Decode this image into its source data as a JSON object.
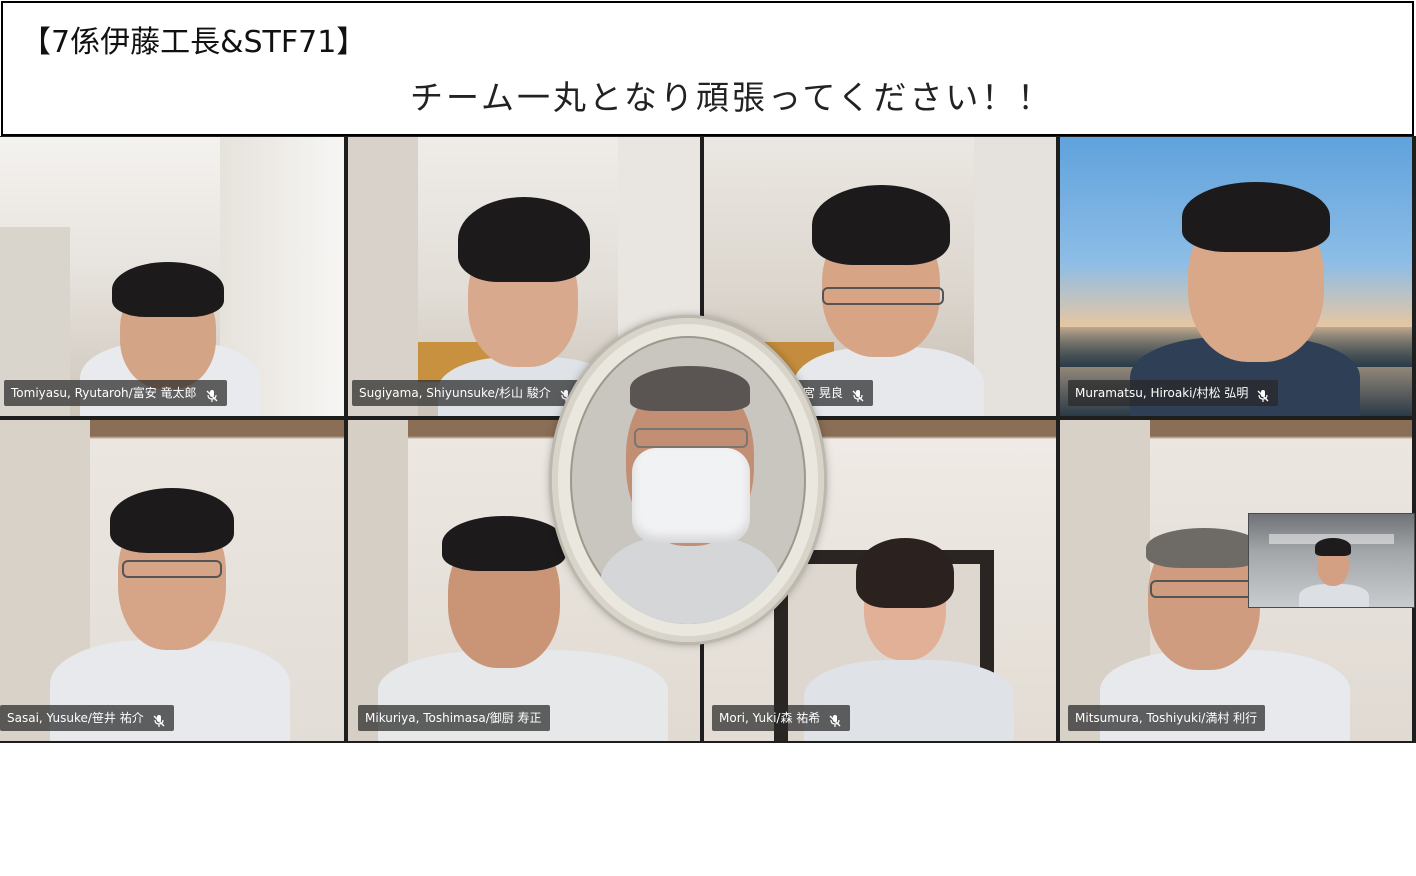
{
  "header": {
    "title": "【7係伊藤工長&STF71】",
    "message": "チーム一丸となり頑張ってください！！"
  },
  "participants": [
    {
      "name": "Tomiyasu, Ryutaroh/富安 竜太郎",
      "muted": true
    },
    {
      "name": "Sugiyama, Shiyunsuke/杉山 駿介",
      "muted": true
    },
    {
      "name": "宮 晃良",
      "muted": true
    },
    {
      "name": "Muramatsu, Hiroaki/村松 弘明",
      "muted": true
    },
    {
      "name": "Sasai, Yusuke/笹井 祐介",
      "muted": true
    },
    {
      "name": "Mikuriya, Toshimasa/御厨 寿正",
      "muted": false
    },
    {
      "name": "Mori, Yuki/森 祐希",
      "muted": true
    },
    {
      "name": "Mitsumura, Toshiyuki/満村 利行",
      "muted": false
    }
  ],
  "colors": {
    "label_bg": "#282828",
    "label_text": "#ffffff",
    "grid_gap": "#1e1e1e",
    "header_border": "#000000"
  },
  "icons": {
    "mute": "microphone-muted-icon"
  }
}
